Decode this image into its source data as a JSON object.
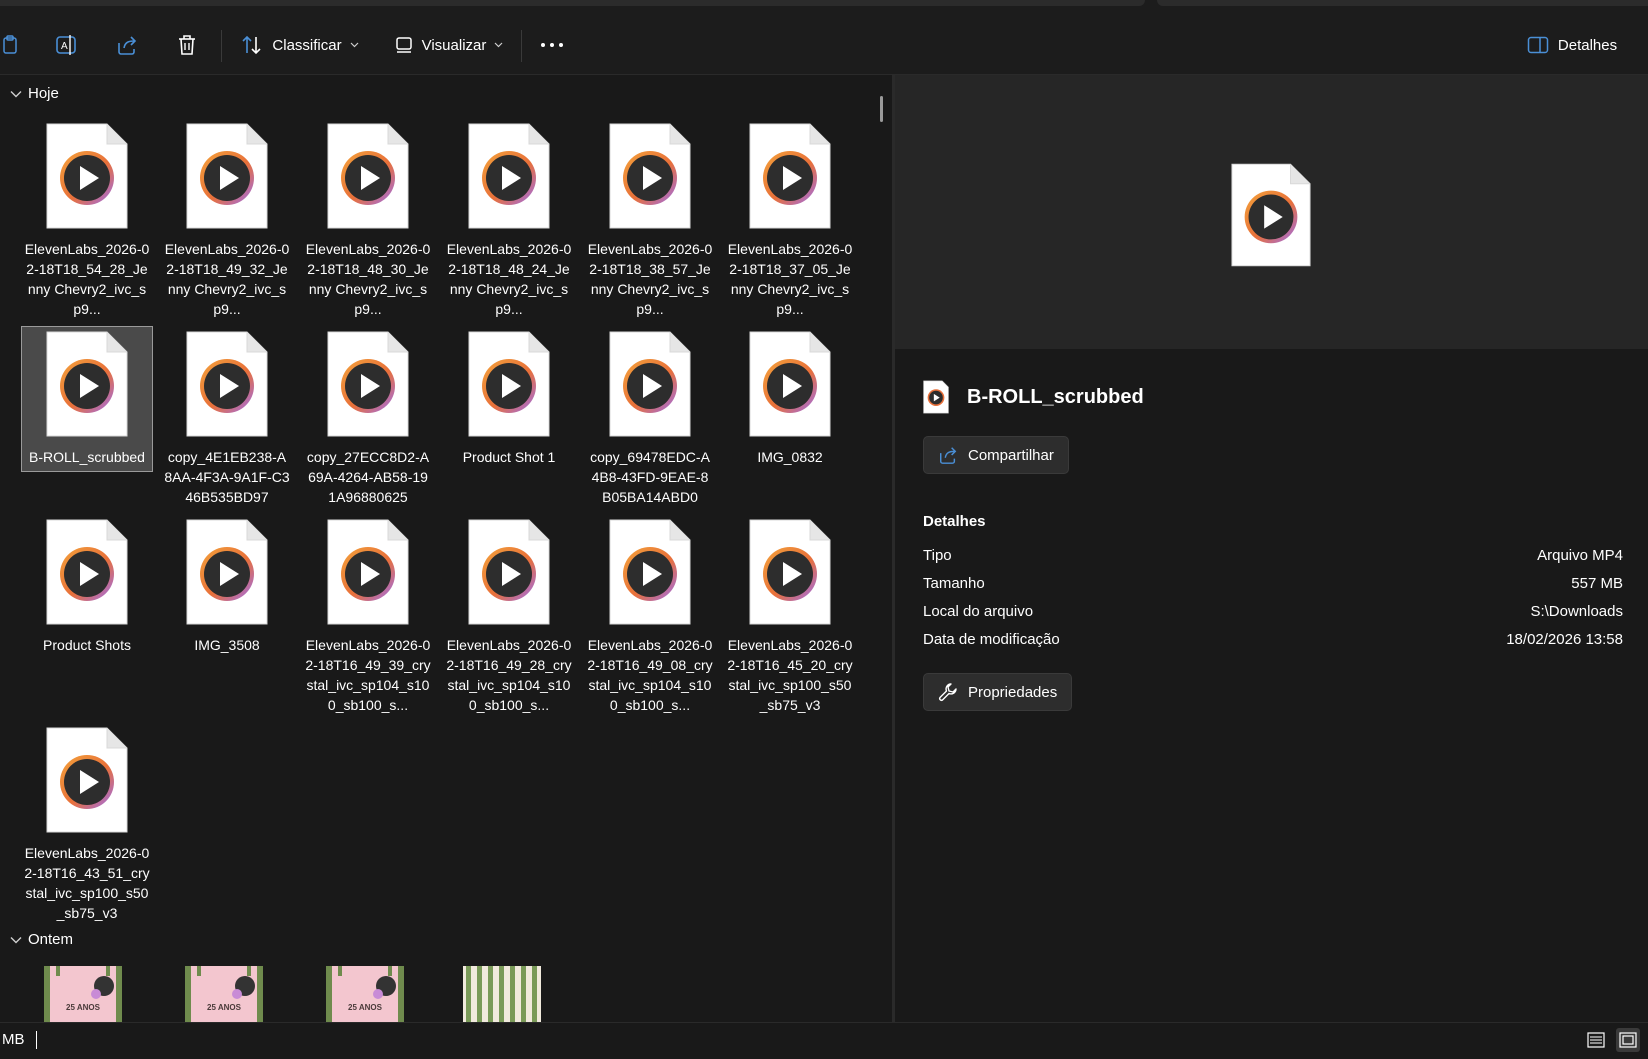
{
  "toolbar": {
    "sort_label": "Classificar",
    "view_label": "Visualizar",
    "details_label": "Detalhes"
  },
  "groups": {
    "today": "Hoje",
    "yesterday": "Ontem"
  },
  "files_row1": [
    "ElevenLabs_2026-02-18T18_54_28_Jenny Chevry2_ivc_sp9...",
    "ElevenLabs_2026-02-18T18_49_32_Jenny Chevry2_ivc_sp9...",
    "ElevenLabs_2026-02-18T18_48_30_Jenny Chevry2_ivc_sp9...",
    "ElevenLabs_2026-02-18T18_48_24_Jenny Chevry2_ivc_sp9...",
    "ElevenLabs_2026-02-18T18_38_57_Jenny Chevry2_ivc_sp9...",
    "ElevenLabs_2026-02-18T18_37_05_Jenny Chevry2_ivc_sp9..."
  ],
  "files_row2": [
    "B-ROLL_scrubbed",
    "copy_4E1EB238-A8AA-4F3A-9A1F-C346B535BD97",
    "copy_27ECC8D2-A69A-4264-AB58-191A96880625",
    "Product Shot 1",
    "copy_69478EDC-A4B8-43FD-9EAE-8B05BA14ABD0",
    "IMG_0832"
  ],
  "files_row3": [
    "Product Shots",
    "IMG_3508",
    "ElevenLabs_2026-02-18T16_49_39_crystal_ivc_sp104_s100_sb100_s...",
    "ElevenLabs_2026-02-18T16_49_28_crystal_ivc_sp104_s100_sb100_s...",
    "ElevenLabs_2026-02-18T16_49_08_crystal_ivc_sp104_s100_sb100_s...",
    "ElevenLabs_2026-02-18T16_45_20_crystal_ivc_sp100_s50_sb75_v3"
  ],
  "files_row4": [
    "ElevenLabs_2026-02-18T16_43_51_crystal_ivc_sp100_s50_sb75_v3"
  ],
  "thumb_text": "25 ANOS",
  "details": {
    "title": "B-ROLL_scrubbed",
    "share_label": "Compartilhar",
    "section": "Detalhes",
    "props": [
      {
        "k": "Tipo",
        "v": "Arquivo MP4"
      },
      {
        "k": "Tamanho",
        "v": "557 MB"
      },
      {
        "k": "Local do arquivo",
        "v": "S:\\Downloads"
      },
      {
        "k": "Data de modificação",
        "v": "18/02/2026 13:58"
      }
    ],
    "properties_label": "Propriedades"
  },
  "status": {
    "text": "MB"
  },
  "colors": {
    "background": "#191919",
    "preview_bg": "#262626",
    "selection": "#4a4a4a",
    "play_ring": "#e8703a"
  }
}
